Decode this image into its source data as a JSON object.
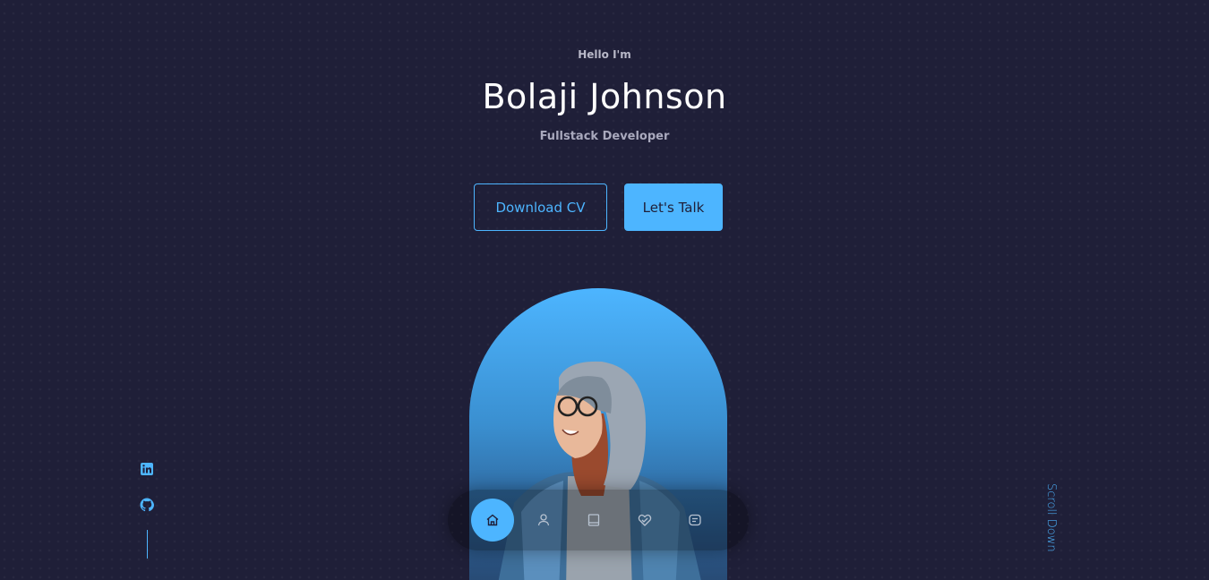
{
  "header": {
    "greeting": "Hello I'm",
    "name": "Bolaji Johnson",
    "role": "Fullstack Developer"
  },
  "cta": {
    "download_label": "Download CV",
    "talk_label": "Let's Talk"
  },
  "socials": [
    {
      "icon": "linkedin-icon"
    },
    {
      "icon": "github-icon"
    }
  ],
  "scroll_label": "Scroll Down",
  "nav": {
    "items": [
      {
        "icon": "home-icon",
        "active": true
      },
      {
        "icon": "user-icon",
        "active": false
      },
      {
        "icon": "book-icon",
        "active": false
      },
      {
        "icon": "services-icon",
        "active": false
      },
      {
        "icon": "message-icon",
        "active": false
      }
    ]
  },
  "colors": {
    "background": "#1f1f38",
    "accent": "#4db5ff",
    "text": "#ffffff",
    "muted": "#b8b8c8"
  }
}
